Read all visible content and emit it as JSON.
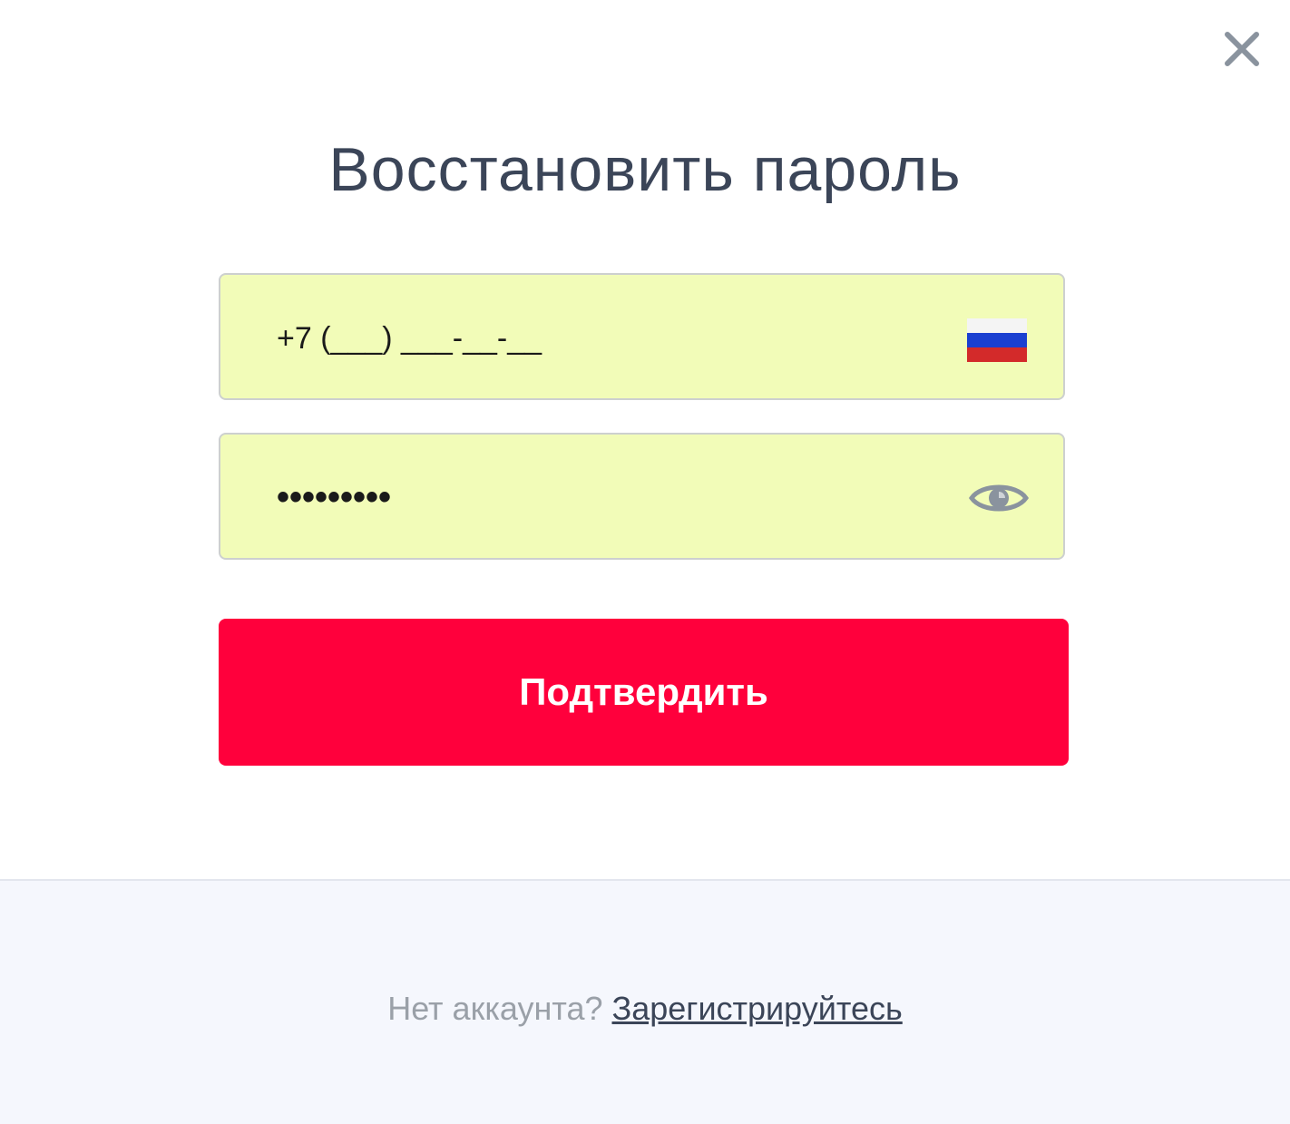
{
  "modal": {
    "title": "Восстановить пароль",
    "close_icon": "close-icon"
  },
  "phone_field": {
    "value": "+7 (___) ___-__-__",
    "country_flag_icon": "russia-flag-icon",
    "background_color": "#f2fcb8"
  },
  "password_field": {
    "value": "•••••••••",
    "toggle_icon": "eye-icon"
  },
  "submit": {
    "label": "Подтвердить",
    "color": "#ff003c"
  },
  "footer": {
    "question": "Нет аккаунта?",
    "link_label": "Зарегистрируйтесь"
  }
}
